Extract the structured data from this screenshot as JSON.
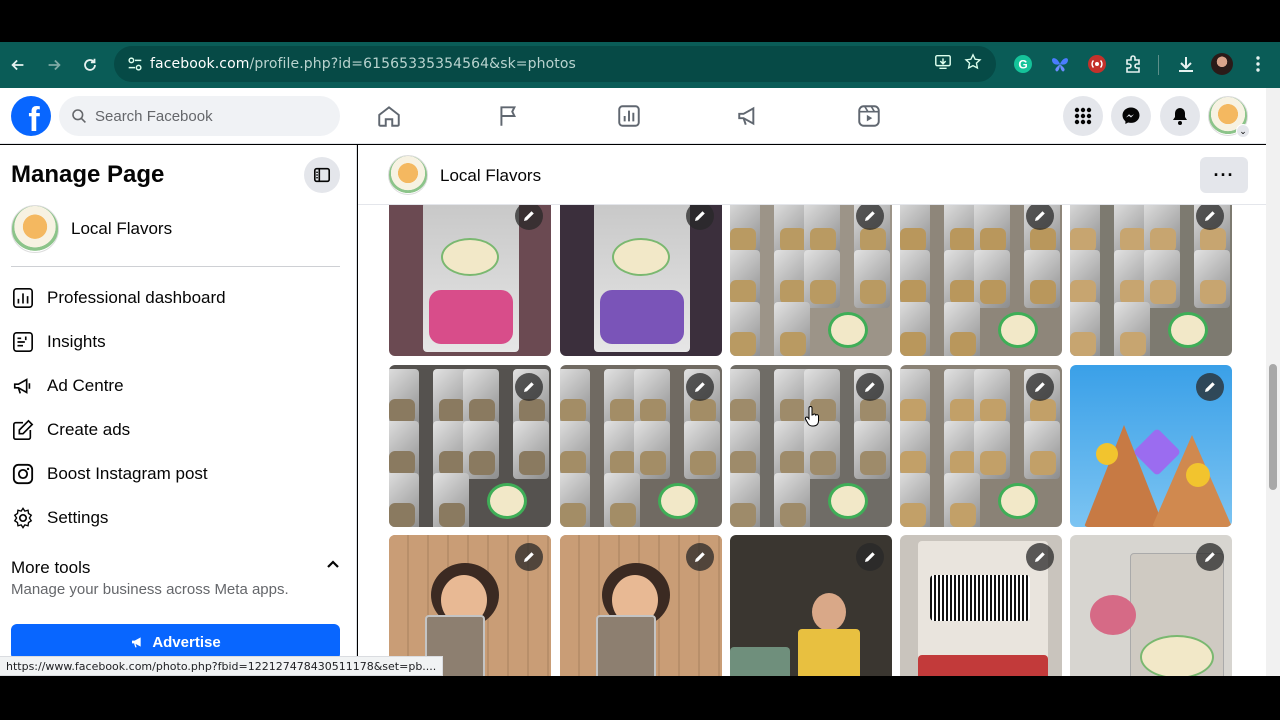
{
  "browser": {
    "url_domain": "facebook.com",
    "url_path": "/profile.php?id=61565335354564&sk=photos",
    "status_url": "https://www.facebook.com/photo.php?fbid=122127478430511178&set=pb...."
  },
  "facebook": {
    "search_placeholder": "Search Facebook",
    "logo": "f"
  },
  "sidebar": {
    "title": "Manage Page",
    "page_name": "Local Flavors",
    "items": [
      {
        "label": "Professional dashboard",
        "icon": "dashboard-icon"
      },
      {
        "label": "Insights",
        "icon": "insights-icon"
      },
      {
        "label": "Ad Centre",
        "icon": "megaphone-icon"
      },
      {
        "label": "Create ads",
        "icon": "pencil-square-icon"
      },
      {
        "label": "Boost Instagram post",
        "icon": "instagram-icon"
      },
      {
        "label": "Settings",
        "icon": "gear-icon"
      }
    ],
    "more_tools": {
      "title": "More tools",
      "subtitle": "Manage your business across Meta apps."
    },
    "advertise_label": "Advertise"
  },
  "main": {
    "page_name": "Local Flavors",
    "more_label": "···"
  },
  "colors": {
    "facebook_blue": "#0866ff",
    "chrome_bar": "#0a5c57"
  }
}
